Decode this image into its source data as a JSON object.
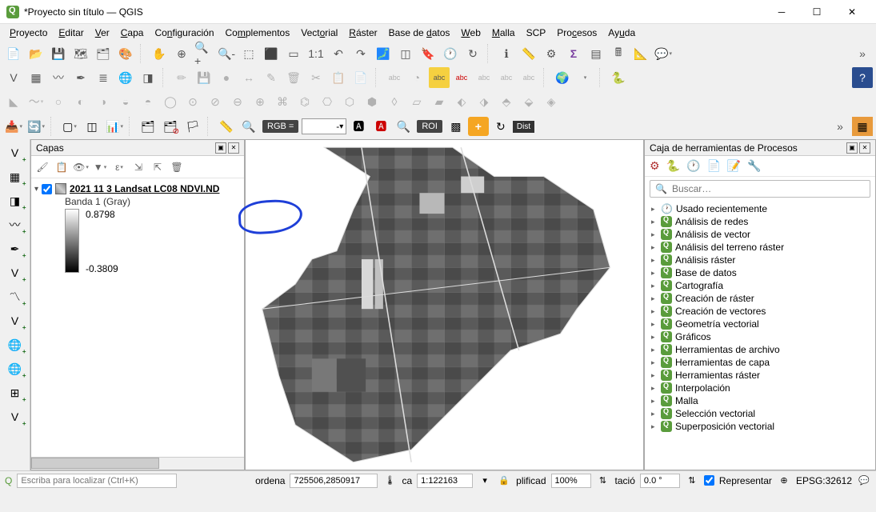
{
  "window": {
    "title": "*Proyecto sin título — QGIS"
  },
  "menu": {
    "items": [
      {
        "label": "Proyecto",
        "u": "P"
      },
      {
        "label": "Editar",
        "u": "E"
      },
      {
        "label": "Ver",
        "u": "V"
      },
      {
        "label": "Capa",
        "u": "C"
      },
      {
        "label": "Configuración",
        "u": "C"
      },
      {
        "label": "Complementos",
        "u": "C"
      },
      {
        "label": "Vectorial",
        "u": "V"
      },
      {
        "label": "Ráster",
        "u": "R"
      },
      {
        "label": "Base de datos",
        "u": "B"
      },
      {
        "label": "Web",
        "u": "W"
      },
      {
        "label": "Malla",
        "u": "M"
      },
      {
        "label": "SCP",
        "u": ""
      },
      {
        "label": "Procesos",
        "u": "P"
      },
      {
        "label": "Ayuda",
        "u": "A"
      }
    ]
  },
  "layers_panel": {
    "title": "Capas",
    "layer_name": "2021 11 3 Landsat LC08 NDVI.ND",
    "band_label": "Banda 1 (Gray)",
    "ramp_max": "0.8798",
    "ramp_min": "-0.3809"
  },
  "processing_panel": {
    "title": "Caja de herramientas de Procesos",
    "search_placeholder": "Buscar…",
    "items": [
      {
        "icon": "clock",
        "label": "Usado recientemente"
      },
      {
        "icon": "qgis",
        "label": "Análisis de redes"
      },
      {
        "icon": "qgis",
        "label": "Análisis de vector"
      },
      {
        "icon": "qgis",
        "label": "Análisis del terreno ráster"
      },
      {
        "icon": "qgis",
        "label": "Análisis ráster"
      },
      {
        "icon": "qgis",
        "label": "Base de datos"
      },
      {
        "icon": "qgis",
        "label": "Cartografía"
      },
      {
        "icon": "qgis",
        "label": "Creación de ráster"
      },
      {
        "icon": "qgis",
        "label": "Creación de vectores"
      },
      {
        "icon": "qgis",
        "label": "Geometría vectorial"
      },
      {
        "icon": "qgis",
        "label": "Gráficos"
      },
      {
        "icon": "qgis",
        "label": "Herramientas de archivo"
      },
      {
        "icon": "qgis",
        "label": "Herramientas de capa"
      },
      {
        "icon": "qgis",
        "label": "Herramientas ráster"
      },
      {
        "icon": "qgis",
        "label": "Interpolación"
      },
      {
        "icon": "qgis",
        "label": "Malla"
      },
      {
        "icon": "qgis",
        "label": "Selección vectorial"
      },
      {
        "icon": "qgis",
        "label": "Superposición vectorial"
      }
    ]
  },
  "scp_toolbar": {
    "rgb_label": "RGB =",
    "rgb_value": "-",
    "roi_label": "ROI",
    "dist_label": "Dist"
  },
  "statusbar": {
    "locator_placeholder": "Escriba para localizar (Ctrl+K)",
    "coord_label": "ordena",
    "coord_value": "725506,2850917",
    "scale_label": "ca",
    "scale_value": "1:122163",
    "magnifier_label": "plificad",
    "magnifier_value": "100%",
    "rotation_label": "tació",
    "rotation_value": "0.0 °",
    "render_label": "Representar",
    "crs_label": "EPSG:32612"
  }
}
